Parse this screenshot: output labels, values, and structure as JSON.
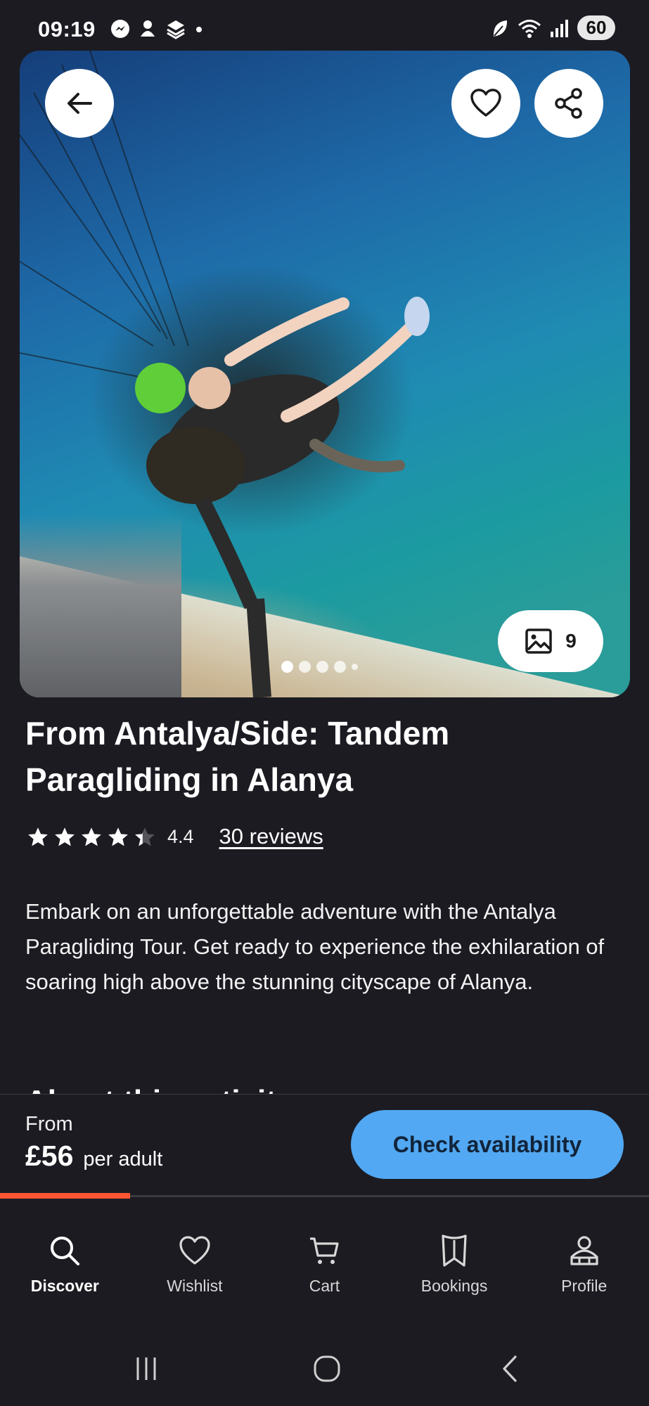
{
  "status_bar": {
    "time": "09:19",
    "battery": "60",
    "left_icons": [
      "messenger-icon",
      "notification-icon",
      "app-icon",
      "dot-icon"
    ],
    "right_icons": [
      "leaf-icon",
      "wifi-icon",
      "signal-icon"
    ]
  },
  "hero": {
    "photo_count": "9",
    "carousel_dots": 5,
    "active_dot": 0
  },
  "activity": {
    "title": "From Antalya/Side: Tandem Paragliding in Alanya",
    "rating_value": "4.4",
    "rating": 4.4,
    "reviews_link": "30 reviews",
    "description": "Embark on an unforgettable adventure with the Antalya Paragliding Tour. Get ready to experience the exhilaration of soaring high above the stunning cityscape of Alanya.",
    "next_section_heading": "About this activity"
  },
  "booking": {
    "from_label": "From",
    "price": "£56",
    "per_label": "per adult",
    "check_button": "Check availability",
    "scroll_progress": 0.2
  },
  "bottom_nav": {
    "items": [
      {
        "label": "Discover",
        "icon": "search-icon",
        "active": true
      },
      {
        "label": "Wishlist",
        "icon": "heart-icon",
        "active": false
      },
      {
        "label": "Cart",
        "icon": "cart-icon",
        "active": false
      },
      {
        "label": "Bookings",
        "icon": "bookings-icon",
        "active": false
      },
      {
        "label": "Profile",
        "icon": "profile-icon",
        "active": false
      }
    ]
  },
  "colors": {
    "background": "#1c1b22",
    "accent_button": "#52a8f2",
    "progress": "#ff5533"
  }
}
